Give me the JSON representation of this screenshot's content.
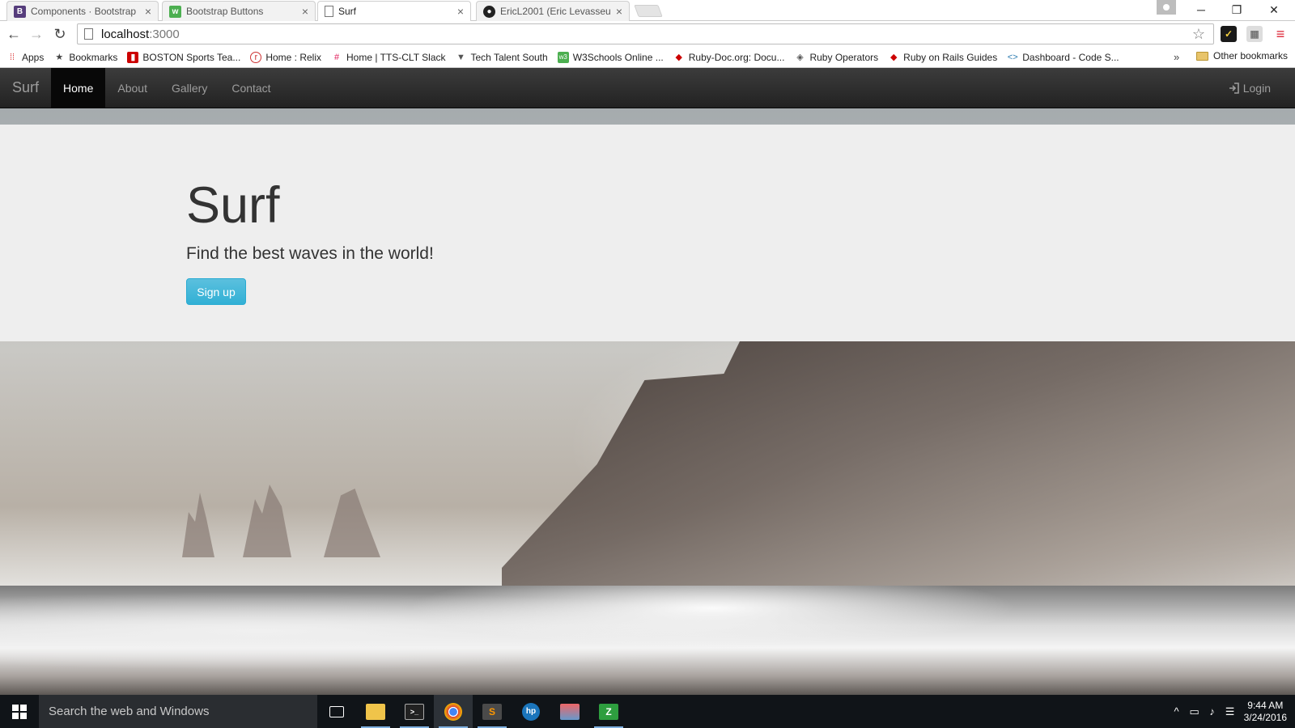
{
  "browser": {
    "tabs": [
      {
        "title": "Components · Bootstrap",
        "favicon": "bootstrap-icon",
        "active": false
      },
      {
        "title": "Bootstrap Buttons",
        "favicon": "w3schools-icon",
        "active": false
      },
      {
        "title": "Surf",
        "favicon": "page-icon",
        "active": true
      },
      {
        "title": "EricL2001 (Eric Levasseur)",
        "favicon": "github-icon",
        "active": false
      }
    ],
    "url_host": "localhost",
    "url_port": ":3000",
    "bookmarks": [
      {
        "label": "Apps",
        "icon": "apps-grid-icon"
      },
      {
        "label": "Bookmarks",
        "icon": "star-icon"
      },
      {
        "label": "BOSTON Sports Tea...",
        "icon": "boston-icon"
      },
      {
        "label": "Home : Relix",
        "icon": "relix-icon"
      },
      {
        "label": "Home | TTS-CLT Slack",
        "icon": "slack-icon"
      },
      {
        "label": "Tech Talent South",
        "icon": "tts-icon"
      },
      {
        "label": "W3Schools Online ...",
        "icon": "w3schools-icon"
      },
      {
        "label": "Ruby-Doc.org: Docu...",
        "icon": "ruby-doc-icon"
      },
      {
        "label": "Ruby Operators",
        "icon": "ruby-operators-icon"
      },
      {
        "label": "Ruby on Rails Guides",
        "icon": "rails-icon"
      },
      {
        "label": "Dashboard - Code S...",
        "icon": "code-icon"
      }
    ],
    "bookmarks_overflow": "»",
    "other_bookmarks": "Other bookmarks"
  },
  "site": {
    "brand": "Surf",
    "nav": [
      {
        "label": "Home",
        "active": true
      },
      {
        "label": "About",
        "active": false
      },
      {
        "label": "Gallery",
        "active": false
      },
      {
        "label": "Contact",
        "active": false
      }
    ],
    "login": "Login",
    "hero": {
      "title": "Surf",
      "subtitle": "Find the best waves in the world!",
      "cta": "Sign up"
    }
  },
  "taskbar": {
    "search_placeholder": "Search the web and Windows",
    "time": "9:44 AM",
    "date": "3/24/2016"
  },
  "colors": {
    "navbar": "#222222",
    "jumbotron": "#eeeeee",
    "button_info": "#5bc0de",
    "taskbar": "#101418"
  }
}
